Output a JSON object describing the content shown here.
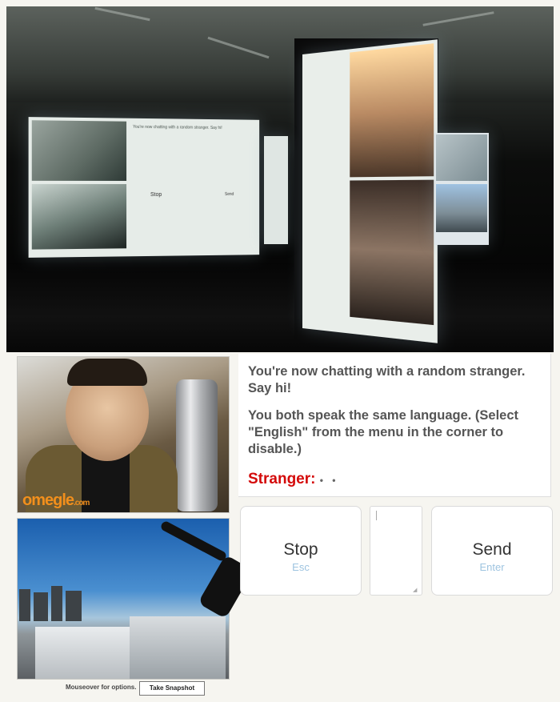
{
  "chat": {
    "intro": "You're now chatting with a random stranger. Say hi!",
    "language_notice": "You both speak the same language. (Select \"English\" from the menu in the corner to disable.)",
    "stranger_label": "Stranger:",
    "typing_indicator": "• •"
  },
  "controls": {
    "stop_label": "Stop",
    "stop_hint": "Esc",
    "send_label": "Send",
    "send_hint": "Enter"
  },
  "video": {
    "logo_text": "omegle",
    "logo_domain": ".com",
    "mouseover_text": "Mouseover for options.",
    "snapshot_label": "Take Snapshot"
  },
  "installation_screen": {
    "intro_small": "You're now chatting with a random stranger. Say hi!",
    "stop_small": "Stop",
    "send_small": "Send"
  },
  "colors": {
    "stranger_red": "#d40a0a",
    "hint_blue": "#9ec4e0",
    "logo_orange": "#f28f1c"
  }
}
